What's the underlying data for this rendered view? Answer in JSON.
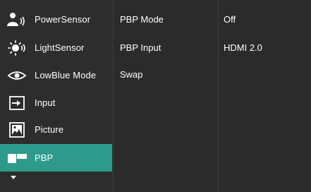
{
  "main_menu": {
    "items": [
      {
        "label": "PowerSensor",
        "icon": "power-sensor-icon"
      },
      {
        "label": "LightSensor",
        "icon": "light-sensor-icon"
      },
      {
        "label": "LowBlue Mode",
        "icon": "eye-icon"
      },
      {
        "label": "Input",
        "icon": "input-icon"
      },
      {
        "label": "Picture",
        "icon": "picture-icon"
      },
      {
        "label": "PBP",
        "icon": "pbp-icon",
        "selected": true
      }
    ],
    "more_indicator": "chevron-down-icon"
  },
  "sub_menu": {
    "items": [
      {
        "label": "PBP Mode"
      },
      {
        "label": "PBP Input"
      },
      {
        "label": "Swap"
      }
    ]
  },
  "values": {
    "items": [
      {
        "label": "Off"
      },
      {
        "label": "HDMI 2.0"
      }
    ]
  },
  "colors": {
    "highlight": "#2d9a8b",
    "background": "#2b2b2b",
    "text": "#ffffff"
  }
}
